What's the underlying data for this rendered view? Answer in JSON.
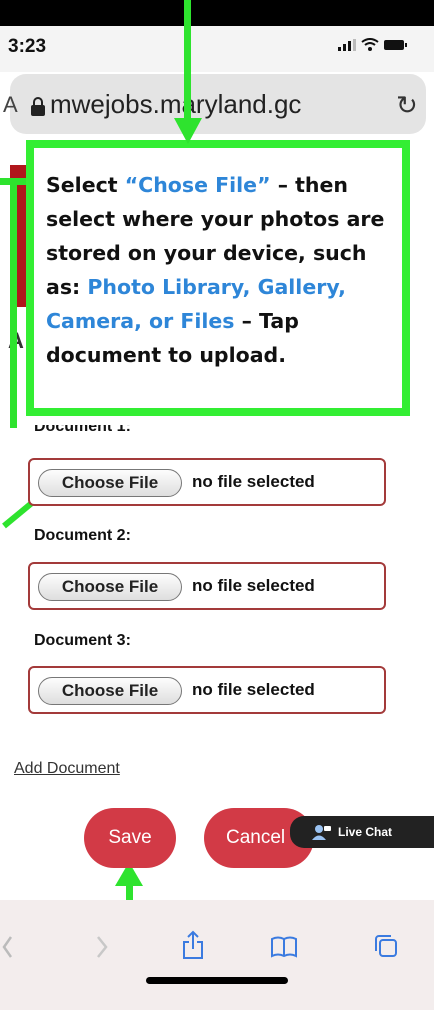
{
  "status_bar": {
    "time": "3:23"
  },
  "address_bar": {
    "url": "mwejobs.maryland.gc",
    "left_fragment": "A"
  },
  "page": {
    "side_letter": "A",
    "header_fragment": "Document 1:"
  },
  "callout": {
    "part1": "Select ",
    "chose_file": "“Chose File”",
    "part2": " – then select where your photos are stored on your device, such as: ",
    "locations": "Photo Library, Gallery, Camera, or Files",
    "part3": " – Tap document to upload."
  },
  "documents": [
    {
      "label": "Document 1:",
      "button": "Choose File",
      "status": "no file selected"
    },
    {
      "label": "Document 2:",
      "button": "Choose File",
      "status": "no file selected"
    },
    {
      "label": "Document 3:",
      "button": "Choose File",
      "status": "no file selected"
    }
  ],
  "actions": {
    "add_document": "Add Document",
    "save": "Save",
    "cancel": "Cancel"
  },
  "live_chat": {
    "label": "Live Chat"
  },
  "colors": {
    "annotation": "#33ee33",
    "button": "#d23a46",
    "highlight": "#2e86d8",
    "field_border": "#a33a3a"
  },
  "icons": [
    "signal-icon",
    "wifi-icon",
    "battery-icon",
    "lock-icon",
    "reload-icon",
    "back-icon",
    "forward-icon",
    "share-icon",
    "bookmarks-icon",
    "tabs-icon",
    "chat-user-icon"
  ]
}
